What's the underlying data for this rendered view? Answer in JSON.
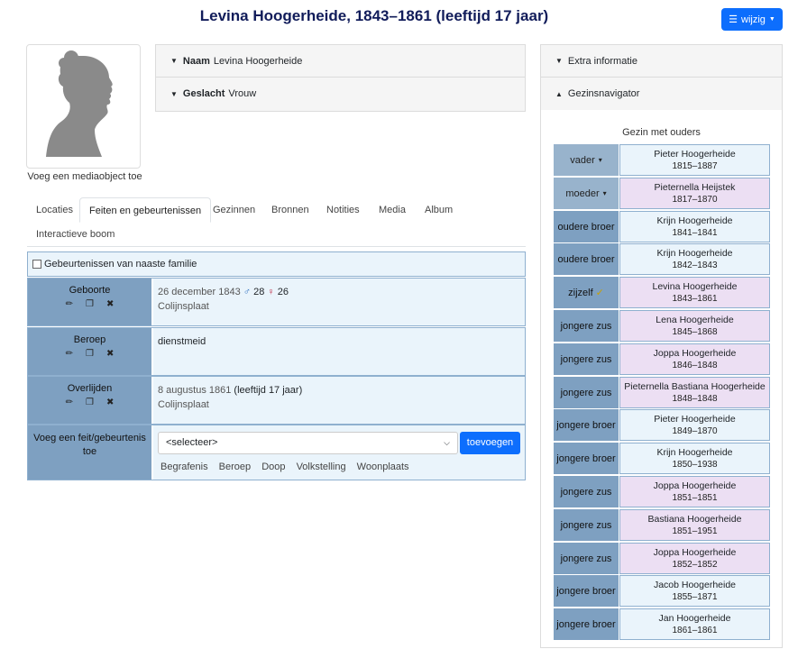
{
  "header": {
    "title": "Levina Hoogerheide, 1843–1861 (leeftijd 17 jaar)",
    "edit_label": "wijzig"
  },
  "photo": {
    "add_label": "Voeg een mediaobject toe"
  },
  "summary": [
    {
      "key": "Naam",
      "value": "Levina Hoogerheide"
    },
    {
      "key": "Geslacht",
      "value": "Vrouw"
    }
  ],
  "tabs": [
    "Locaties",
    "Feiten en gebeurtenissen",
    "Gezinnen",
    "Bronnen",
    "Notities",
    "Media",
    "Album",
    "Interactieve boom"
  ],
  "events": {
    "family_check": "Gebeurtenissen van naaste familie",
    "birth": {
      "label": "Geboorte",
      "date": "26 december 1843",
      "father_age": "28",
      "mother_age": "26",
      "place": "Colijnsplaat"
    },
    "occupation": {
      "label": "Beroep",
      "value": "dienstmeid"
    },
    "death": {
      "label": "Overlijden",
      "date": "8 augustus 1861",
      "age": "(leeftijd 17 jaar)",
      "place": "Colijnsplaat"
    },
    "add": {
      "label": "Voeg een feit/gebeurtenis toe",
      "select": "<selecteer>",
      "button": "toevoegen",
      "quick": [
        "Begrafenis",
        "Beroep",
        "Doop",
        "Volkstelling",
        "Woonplaats"
      ]
    }
  },
  "sidebar": {
    "extra": "Extra informatie",
    "navigator": "Gezinsnavigator",
    "family_title": "Gezin met ouders",
    "members": [
      {
        "rel": "vader",
        "name": "Pieter Hoogerheide",
        "dates": "1815–1887",
        "sex": "m"
      },
      {
        "rel": "moeder",
        "name": "Pieternella Heijstek",
        "dates": "1817–1870",
        "sex": "f"
      },
      {
        "rel": "oudere broer",
        "name": "Krijn Hoogerheide",
        "dates": "1841–1841",
        "sex": "m"
      },
      {
        "rel": "oudere broer",
        "name": "Krijn Hoogerheide",
        "dates": "1842–1843",
        "sex": "m"
      },
      {
        "rel": "zijzelf",
        "name": "Levina Hoogerheide",
        "dates": "1843–1861",
        "sex": "f"
      },
      {
        "rel": "jongere zus",
        "name": "Lena Hoogerheide",
        "dates": "1845–1868",
        "sex": "f"
      },
      {
        "rel": "jongere zus",
        "name": "Joppa Hoogerheide",
        "dates": "1846–1848",
        "sex": "f"
      },
      {
        "rel": "jongere zus",
        "name": "Pieternella Bastiana Hoogerheide",
        "dates": "1848–1848",
        "sex": "f"
      },
      {
        "rel": "jongere broer",
        "name": "Pieter Hoogerheide",
        "dates": "1849–1870",
        "sex": "m"
      },
      {
        "rel": "jongere broer",
        "name": "Krijn Hoogerheide",
        "dates": "1850–1938",
        "sex": "m"
      },
      {
        "rel": "jongere zus",
        "name": "Joppa Hoogerheide",
        "dates": "1851–1851",
        "sex": "f"
      },
      {
        "rel": "jongere zus",
        "name": "Bastiana Hoogerheide",
        "dates": "1851–1951",
        "sex": "f"
      },
      {
        "rel": "jongere zus",
        "name": "Joppa Hoogerheide",
        "dates": "1852–1852",
        "sex": "f"
      },
      {
        "rel": "jongere broer",
        "name": "Jacob Hoogerheide",
        "dates": "1855–1871",
        "sex": "m"
      },
      {
        "rel": "jongere broer",
        "name": "Jan Hoogerheide",
        "dates": "1861–1861",
        "sex": "m"
      }
    ]
  }
}
